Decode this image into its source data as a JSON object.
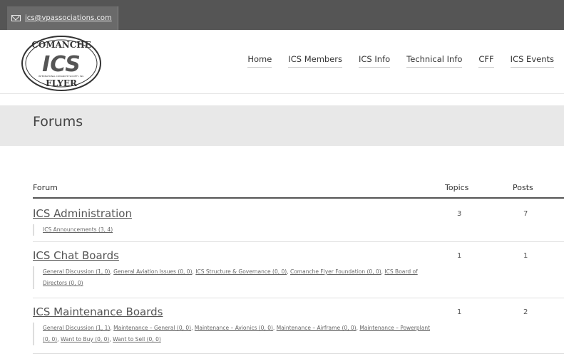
{
  "topbar": {
    "email": "ics@vpassociations.com",
    "email_icon": "mail-icon"
  },
  "logo": {
    "line1": "COMANCHE",
    "mark": "ICS",
    "tiny": "INTERNATIONAL COMANCHE SOCIETY, INC.",
    "line2": "FLYER"
  },
  "nav": [
    {
      "label": "Home"
    },
    {
      "label": "ICS Members"
    },
    {
      "label": "ICS Info"
    },
    {
      "label": "Technical Info"
    },
    {
      "label": "CFF"
    },
    {
      "label": "ICS Events"
    }
  ],
  "page": {
    "title": "Forums"
  },
  "table": {
    "headers": {
      "forum": "Forum",
      "topics": "Topics",
      "posts": "Posts"
    },
    "rows": [
      {
        "name": "ICS Administration",
        "topics": "3",
        "posts": "7",
        "subforums": [
          "ICS Announcements (3, 4)"
        ]
      },
      {
        "name": "ICS Chat Boards",
        "topics": "1",
        "posts": "1",
        "subforums": [
          "General Discussion (1, 0)",
          "General Aviation Issues (0, 0)",
          "ICS Structure & Governance (0, 0)",
          "Comanche Flyer Foundation (0, 0)",
          "ICS Board of Directors (0, 0)"
        ]
      },
      {
        "name": "ICS Maintenance Boards",
        "topics": "1",
        "posts": "2",
        "subforums": [
          "General Discussion (1, 1)",
          "Maintenance – General (0, 0)",
          "Maintenance – Avionics (0, 0)",
          "Maintenance – Airframe (0, 0)",
          "Maintenance – Powerplant (0, 0)",
          "Want to Buy (0, 0)",
          "Want to Sell (0, 0)"
        ]
      }
    ]
  }
}
